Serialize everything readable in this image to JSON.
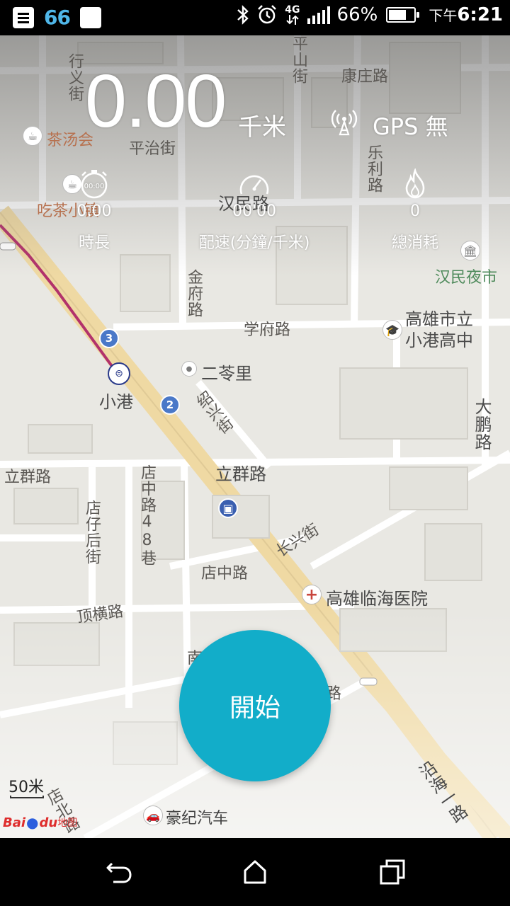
{
  "status_bar": {
    "app_badge": "66",
    "battery_percent": "66%",
    "battery_level": 0.66,
    "network_type": "4G",
    "time_prefix": "下午",
    "time": "6:21",
    "icons": [
      "notification-icon",
      "app-66-icon",
      "white-square-icon",
      "bluetooth-icon",
      "alarm-icon",
      "4g-icon",
      "signal-icon",
      "battery-icon"
    ]
  },
  "tracker": {
    "distance": "0.00",
    "distance_unit": "千米",
    "gps_label": "GPS 無",
    "stats": [
      {
        "icon": "stopwatch-icon",
        "value": "0.00",
        "label": "時長"
      },
      {
        "icon": "speedometer-icon",
        "value": "00'00",
        "label": "配速(分鐘/千米)"
      },
      {
        "icon": "flame-icon",
        "value": "0",
        "label": "總消耗"
      }
    ],
    "start_label": "開始"
  },
  "map": {
    "labels": {
      "xingyi_street": "行义街",
      "pingshan_street": "平山街",
      "kangzhuang_road": "康庄路",
      "chatanghui": "茶汤会",
      "pingzhi_street": "平治街",
      "leli_road": "乐利路",
      "chichaxiaozhen": "吃茶小镇",
      "hanmin_road": "汉民路",
      "hanmin_night_market": "汉民夜市",
      "jinfu_road": "金府路",
      "xuefu_road": "学府路",
      "kaohsiung_school": "高雄市立\n小港高中",
      "erlingli": "二苓里",
      "xiaogang": "小港",
      "shaoxing_street": "绍兴街",
      "dapeng_road": "大鹏路",
      "liqun_road_left": "立群路",
      "liqun_road_center": "立群路",
      "dianzhong_lane": "店中路48巷",
      "dianzihou_street": "店仔后街",
      "changxing_street": "长兴街",
      "dianzhong_road": "店中路",
      "hospital": "高雄临海医院",
      "dingheng_road": "顶横路",
      "nan": "南",
      "lu": "路",
      "yanhai_road": "沿海一路",
      "dianbei_road": "店北路",
      "haoji_auto": "豪纪汽车"
    },
    "metro_numbers": [
      "3",
      "2"
    ],
    "scale": "50米",
    "logo": {
      "bai": "Bai",
      "du": "du",
      "ditu": "地图"
    }
  },
  "nav_bar": {
    "buttons": [
      "back-icon",
      "home-icon",
      "recents-icon"
    ]
  },
  "colors": {
    "accent": "#12adc9",
    "metro_line": "#b2326b",
    "highway": "#efd9a3"
  }
}
